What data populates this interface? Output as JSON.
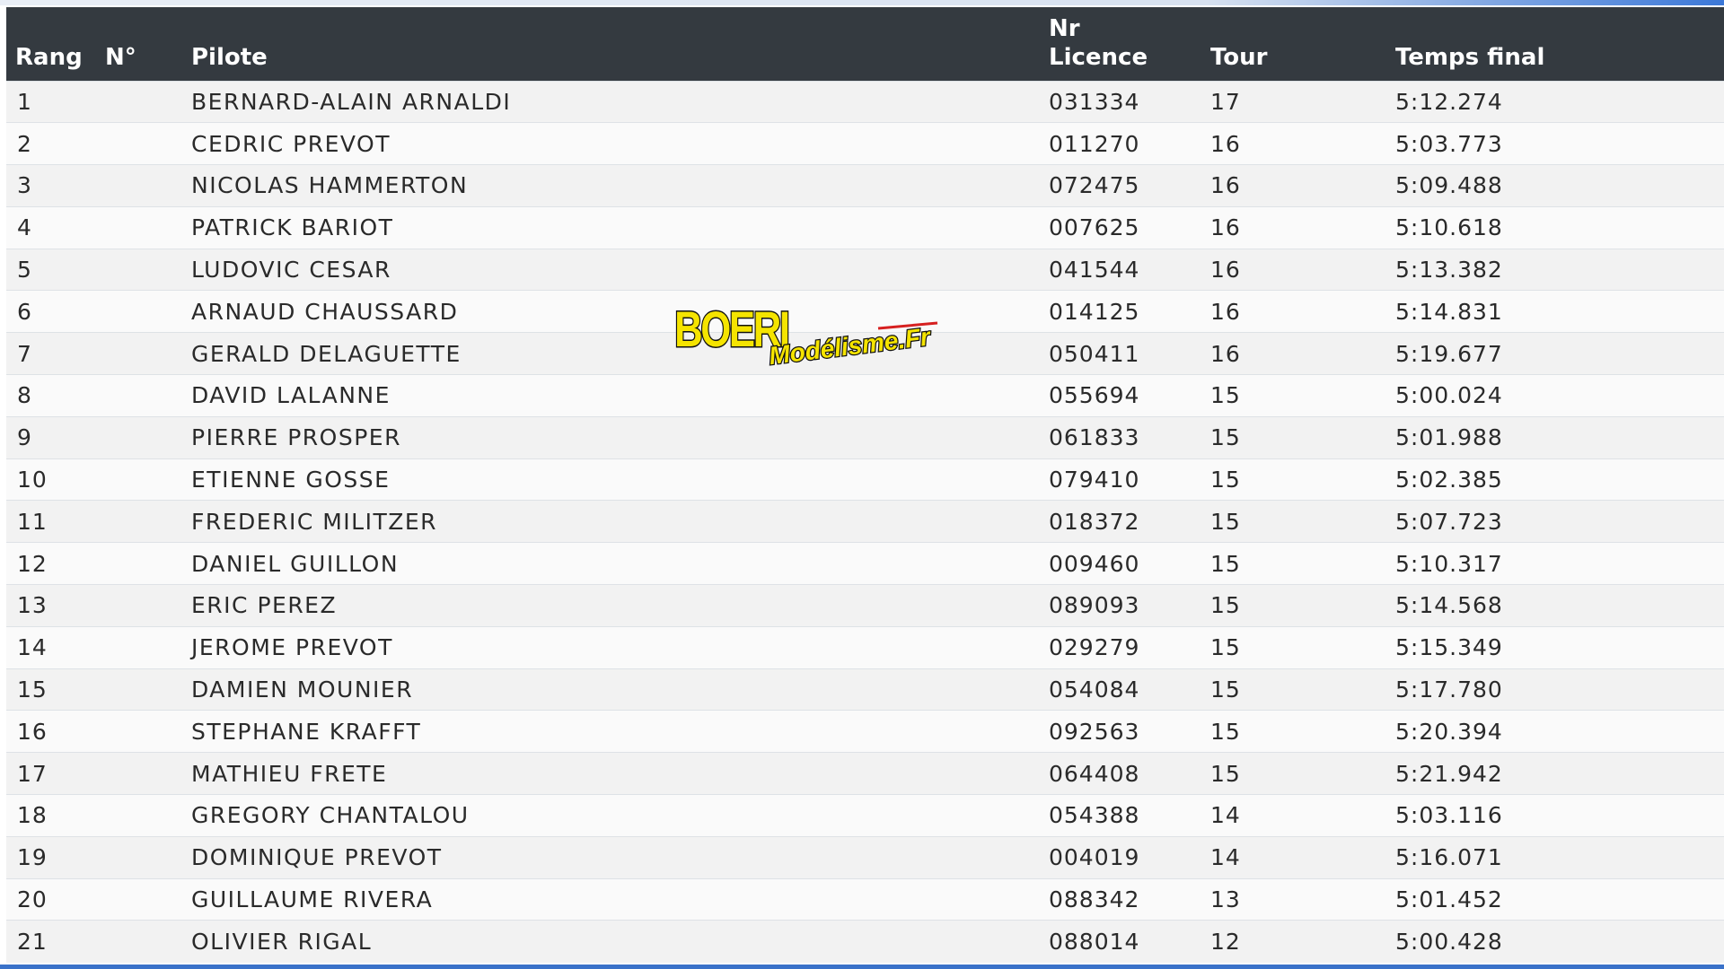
{
  "table": {
    "headers": {
      "rang": "Rang",
      "num": "N°",
      "pilote": "Pilote",
      "licence": "Nr\nLicence",
      "tour": "Tour",
      "temps": "Temps final"
    },
    "rows": [
      {
        "rang": "1",
        "num": "",
        "pilote": "BERNARD-ALAIN ARNALDI",
        "licence": "031334",
        "tour": "17",
        "temps": "5:12.274"
      },
      {
        "rang": "2",
        "num": "",
        "pilote": "CEDRIC PREVOT",
        "licence": "011270",
        "tour": "16",
        "temps": "5:03.773"
      },
      {
        "rang": "3",
        "num": "",
        "pilote": "NICOLAS HAMMERTON",
        "licence": "072475",
        "tour": "16",
        "temps": "5:09.488"
      },
      {
        "rang": "4",
        "num": "",
        "pilote": "PATRICK BARIOT",
        "licence": "007625",
        "tour": "16",
        "temps": "5:10.618"
      },
      {
        "rang": "5",
        "num": "",
        "pilote": "LUDOVIC CESAR",
        "licence": "041544",
        "tour": "16",
        "temps": "5:13.382"
      },
      {
        "rang": "6",
        "num": "",
        "pilote": "ARNAUD CHAUSSARD",
        "licence": "014125",
        "tour": "16",
        "temps": "5:14.831"
      },
      {
        "rang": "7",
        "num": "",
        "pilote": "GERALD DELAGUETTE",
        "licence": "050411",
        "tour": "16",
        "temps": "5:19.677"
      },
      {
        "rang": "8",
        "num": "",
        "pilote": "DAVID LALANNE",
        "licence": "055694",
        "tour": "15",
        "temps": "5:00.024"
      },
      {
        "rang": "9",
        "num": "",
        "pilote": "PIERRE PROSPER",
        "licence": "061833",
        "tour": "15",
        "temps": "5:01.988"
      },
      {
        "rang": "10",
        "num": "",
        "pilote": "ETIENNE GOSSE",
        "licence": "079410",
        "tour": "15",
        "temps": "5:02.385"
      },
      {
        "rang": "11",
        "num": "",
        "pilote": "FREDERIC MILITZER",
        "licence": "018372",
        "tour": "15",
        "temps": "5:07.723"
      },
      {
        "rang": "12",
        "num": "",
        "pilote": "DANIEL GUILLON",
        "licence": "009460",
        "tour": "15",
        "temps": "5:10.317"
      },
      {
        "rang": "13",
        "num": "",
        "pilote": "ERIC PEREZ",
        "licence": "089093",
        "tour": "15",
        "temps": "5:14.568"
      },
      {
        "rang": "14",
        "num": "",
        "pilote": "JEROME PREVOT",
        "licence": "029279",
        "tour": "15",
        "temps": "5:15.349"
      },
      {
        "rang": "15",
        "num": "",
        "pilote": "DAMIEN MOUNIER",
        "licence": "054084",
        "tour": "15",
        "temps": "5:17.780"
      },
      {
        "rang": "16",
        "num": "",
        "pilote": "STEPHANE KRAFFT",
        "licence": "092563",
        "tour": "15",
        "temps": "5:20.394"
      },
      {
        "rang": "17",
        "num": "",
        "pilote": "MATHIEU FRETE",
        "licence": "064408",
        "tour": "15",
        "temps": "5:21.942"
      },
      {
        "rang": "18",
        "num": "",
        "pilote": "GREGORY CHANTALOU",
        "licence": "054388",
        "tour": "14",
        "temps": "5:03.116"
      },
      {
        "rang": "19",
        "num": "",
        "pilote": "DOMINIQUE PREVOT",
        "licence": "004019",
        "tour": "14",
        "temps": "5:16.071"
      },
      {
        "rang": "20",
        "num": "",
        "pilote": "GUILLAUME RIVERA",
        "licence": "088342",
        "tour": "13",
        "temps": "5:01.452"
      },
      {
        "rang": "21",
        "num": "",
        "pilote": "OLIVIER RIGAL",
        "licence": "088014",
        "tour": "12",
        "temps": "5:00.428"
      }
    ]
  },
  "watermark": {
    "brand": "BOERI",
    "tagline": "Modélisme.Fr",
    "colors": {
      "fill": "#f5e400",
      "outline": "#111111",
      "accent": "#d62020"
    }
  },
  "colors": {
    "header_bg": "#343a40",
    "header_text": "#ffffff",
    "row_odd": "#f2f2f2",
    "row_even": "#fafafa",
    "row_border": "#dee2e6",
    "accent_bar": "#3a72c9"
  }
}
